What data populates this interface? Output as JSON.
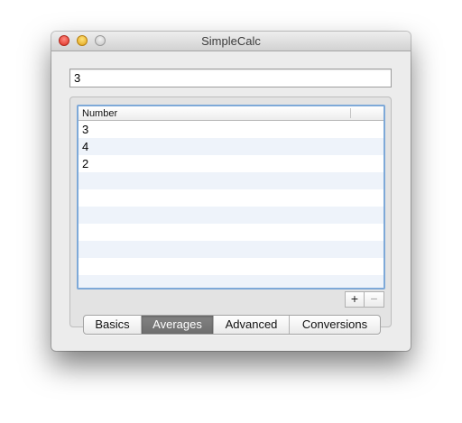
{
  "window": {
    "title": "SimpleCalc"
  },
  "display": {
    "value": "3"
  },
  "table": {
    "column_header": "Number",
    "rows": [
      "3",
      "4",
      "2",
      "",
      "",
      "",
      "",
      "",
      "",
      ""
    ]
  },
  "buttons": {
    "add": "+",
    "remove": "−"
  },
  "tabs": [
    {
      "label": "Basics",
      "selected": false
    },
    {
      "label": "Averages",
      "selected": true
    },
    {
      "label": "Advanced",
      "selected": false
    },
    {
      "label": "Conversions",
      "selected": false
    }
  ]
}
